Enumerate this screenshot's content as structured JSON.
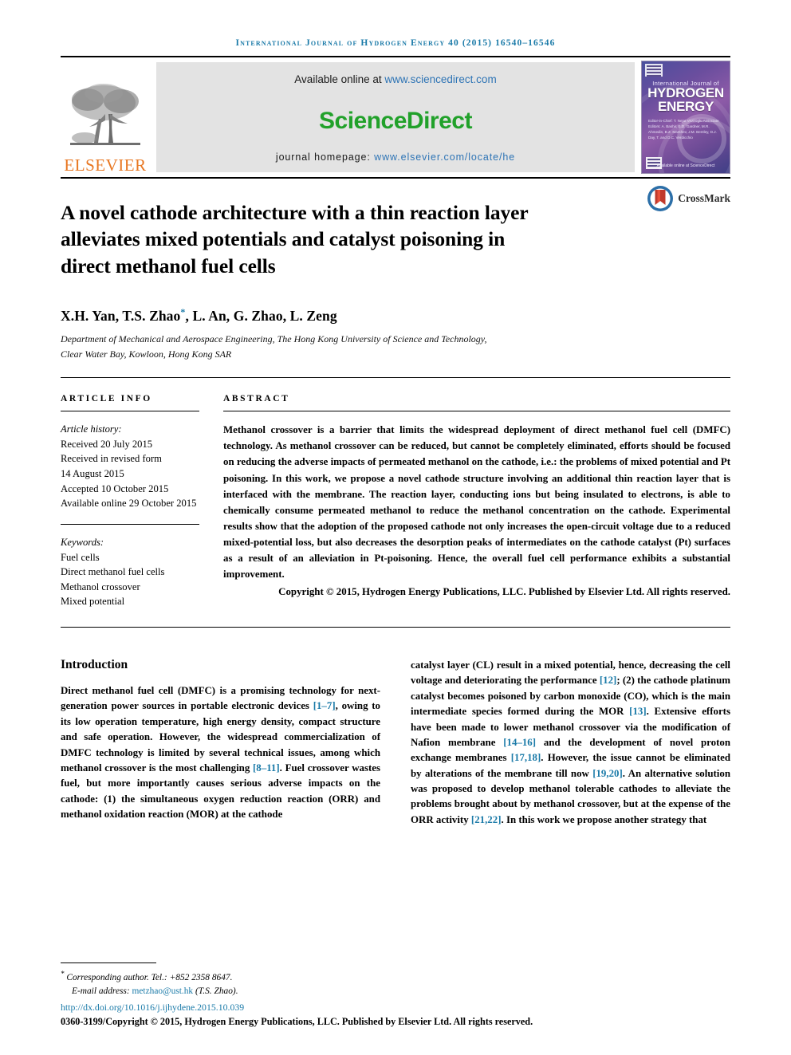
{
  "running_head": "International Journal of Hydrogen Energy 40 (2015) 16540–16546",
  "masthead": {
    "publisher_name": "ELSEVIER",
    "available_prefix": "Available online at ",
    "available_url": "www.sciencedirect.com",
    "sciencedirect_word": "ScienceDirect",
    "journal_homepage_label": "journal homepage: ",
    "journal_homepage_url": "www.elsevier.com/locate/he",
    "cover": {
      "line_small": "International Journal of",
      "line_big_1": "HYDROGEN",
      "line_big_2": "ENERGY",
      "editors": "Editor-in-Chief:  T. Nejat Veziroglu\nAssociate Editors:  A. Bashir, E.D. Gardner, M.R. Ahmedin,\nB.Z. Marshev, J.M. Bentley,\nD.J. Day, T. and D.C. Verdicchio",
      "footer": "Available online at\nScienceDirect"
    }
  },
  "article": {
    "title": "A novel cathode architecture with a thin reaction layer alleviates mixed potentials and catalyst poisoning in direct methanol fuel cells",
    "crossmark_label": "CrossMark",
    "authors": "X.H. Yan, T.S. Zhao",
    "authors_rest": ", L. An, G. Zhao, L. Zeng",
    "affiliation_line1": "Department of Mechanical and Aerospace Engineering, The Hong Kong University of Science and Technology,",
    "affiliation_line2": "Clear Water Bay, Kowloon, Hong Kong SAR"
  },
  "info": {
    "heading": "ARTICLE INFO",
    "history_title": "Article history:",
    "history": [
      "Received 20 July 2015",
      "Received in revised form",
      "14 August 2015",
      "Accepted 10 October 2015",
      "Available online 29 October 2015"
    ],
    "keywords_title": "Keywords:",
    "keywords": [
      "Fuel cells",
      "Direct methanol fuel cells",
      "Methanol crossover",
      "Mixed potential"
    ]
  },
  "abstract": {
    "heading": "ABSTRACT",
    "text": "Methanol crossover is a barrier that limits the widespread deployment of direct methanol fuel cell (DMFC) technology. As methanol crossover can be reduced, but cannot be completely eliminated, efforts should be focused on reducing the adverse impacts of permeated methanol on the cathode, i.e.: the problems of mixed potential and Pt poisoning. In this work, we propose a novel cathode structure involving an additional thin reaction layer that is interfaced with the membrane. The reaction layer, conducting ions but being insulated to electrons, is able to chemically consume permeated methanol to reduce the methanol concentration on the cathode. Experimental results show that the adoption of the proposed cathode not only increases the open-circuit voltage due to a reduced mixed-potential loss, but also decreases the desorption peaks of intermediates on the cathode catalyst (Pt) surfaces as a result of an alleviation in Pt-poisoning. Hence, the overall fuel cell performance exhibits a substantial improvement.",
    "copyright": "Copyright © 2015, Hydrogen Energy Publications, LLC. Published by Elsevier Ltd. All rights reserved."
  },
  "body": {
    "section_title": "Introduction",
    "left_column": {
      "p1_a": "Direct methanol fuel cell (DMFC) is a promising technology for next-generation power sources in portable electronic devices ",
      "cit1": "[1–7]",
      "p1_b": ", owing to its low operation temperature, high energy density, compact structure and safe operation. However, the widespread commercialization of DMFC technology is limited by several technical issues, among which methanol crossover is the most challenging ",
      "cit2": "[8–11]",
      "p1_c": ". Fuel crossover wastes fuel, but more importantly causes serious adverse impacts on the cathode: (1) the simultaneous oxygen reduction reaction (ORR) and methanol oxidation reaction (MOR) at the cathode"
    },
    "right_column": {
      "p_a": "catalyst layer (CL) result in a mixed potential, hence, decreasing the cell voltage and deteriorating the performance ",
      "cit12": "[12]",
      "p_b": "; (2) the cathode platinum catalyst becomes poisoned by carbon monoxide (CO), which is the main intermediate species formed during the MOR ",
      "cit13": "[13]",
      "p_c": ". Extensive efforts have been made to lower methanol crossover via the modification of Nafion membrane ",
      "cit14": "[14–16]",
      "p_d": " and the development of novel proton exchange membranes ",
      "cit17": "[17,18]",
      "p_e": ". However, the issue cannot be eliminated by alterations of the membrane till now ",
      "cit19": "[19,20]",
      "p_f": ". An alternative solution was proposed to develop methanol tolerable cathodes to alleviate the problems brought about by methanol crossover, but at the expense of the ORR activity ",
      "cit21": "[21,22]",
      "p_g": ". In this work we propose another strategy that"
    }
  },
  "footnote": {
    "corresponding": "Corresponding author. Tel.: +852 2358 8647.",
    "email_label": "E-mail address: ",
    "email": "metzhao@ust.hk",
    "email_suffix": " (T.S. Zhao).",
    "doi": "http://dx.doi.org/10.1016/j.ijhydene.2015.10.039",
    "copyright_line": "0360-3199/Copyright © 2015, Hydrogen Energy Publications, LLC. Published by Elsevier Ltd. All rights reserved."
  },
  "colors": {
    "link_blue": "#1a7aa8",
    "sciencedirect_green": "#21a12a",
    "elsevier_orange": "#E87722"
  }
}
